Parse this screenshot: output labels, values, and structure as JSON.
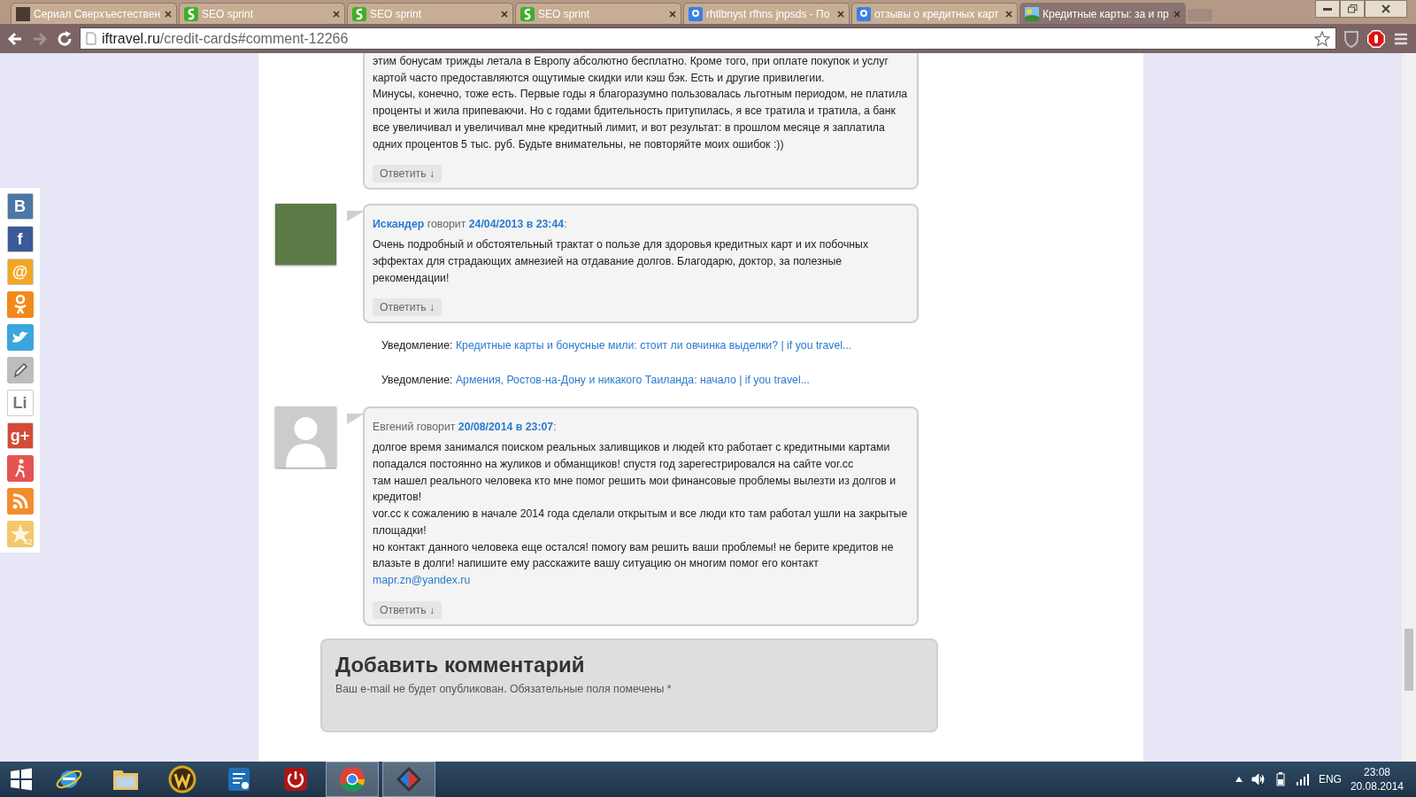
{
  "browser": {
    "tabs": [
      {
        "title": "Сериал Сверхъестествен",
        "kind": "thumbnail",
        "selected": false
      },
      {
        "title": "SEO sprint",
        "kind": "seo",
        "selected": false
      },
      {
        "title": "SEO sprint",
        "kind": "seo",
        "selected": false
      },
      {
        "title": "SEO sprint",
        "kind": "seo",
        "selected": false
      },
      {
        "title": "rhtlbnyst rfhns jnpsds - По",
        "kind": "tile",
        "selected": false
      },
      {
        "title": "отзывы о кредитных карт",
        "kind": "tile",
        "selected": false
      },
      {
        "title": "Кредитные карты: за и пр",
        "kind": "landscape",
        "selected": true
      }
    ],
    "url_host": "iftravel.ru",
    "url_path": "/credit-cards#comment-12266"
  },
  "share_bar": {
    "items": [
      {
        "kind": "vk",
        "glyph": "B"
      },
      {
        "kind": "facebook",
        "glyph": "f"
      },
      {
        "kind": "mail",
        "glyph": "@"
      },
      {
        "kind": "odnoklassniki"
      },
      {
        "kind": "twitter"
      },
      {
        "kind": "pencil"
      },
      {
        "kind": "liveinternet",
        "glyph": "Li"
      },
      {
        "kind": "googleplus",
        "glyph": "g+"
      },
      {
        "kind": "person"
      },
      {
        "kind": "rss"
      },
      {
        "kind": "star",
        "count": "42"
      }
    ]
  },
  "comments": [
    {
      "kind": "continued",
      "lines": [
        {
          "text": "этим бонусам трижды летала в Европу абсолютно бесплатно. Кроме того, при оплате покупок и услуг"
        },
        {
          "text": "картой часто предоставляются ощутимые скидки или кэш бэк. Есть и другие привилегии."
        },
        {
          "text": "Минусы, конечно, тоже есть. Первые годы я благоразумно пользовалась льготным периодом, не платила"
        },
        {
          "text": "проценты и жила припеваючи. Но с годами бдительность притупилась, я все тратила и тратила, а банк"
        },
        {
          "text": "все увеличивал и увеличивал мне кредитный лимит, и вот результат: в прошлом месяце я заплатила"
        },
        {
          "text": "одних процентов 5 тыс. руб. Будьте внимательны, не повторяйте моих ошибок :))"
        }
      ],
      "reply": "Ответить ↓"
    },
    {
      "kind": "photo",
      "author": {
        "name": "Искандер",
        "linked": true
      },
      "says": "говорит",
      "date": "24/04/2013 в 23:44",
      "separator": ":",
      "lines": [
        {
          "text": "Очень подробный и обстоятельный трактат о пользе для здоровья кредитных карт и их побочных"
        },
        {
          "text": "эффектах для страдающих амнезией на отдавание долгов. Благодарю, доктор, за полезные"
        },
        {
          "text": "рекомендации!"
        }
      ],
      "reply": "Ответить ↓"
    },
    {
      "kind": "notification",
      "label": "Уведомление:",
      "link": "Кредитные карты и бонусные мили: стоит ли овчинка выделки? | if you travel..."
    },
    {
      "kind": "notification",
      "label": "Уведомление:",
      "link": "Армения, Ростов-на-Дону и никакого Таиланда: начало | if you travel..."
    },
    {
      "kind": "default",
      "author": {
        "name": "Евгений",
        "linked": false
      },
      "says": "говорит",
      "date": "20/08/2014 в 23:07",
      "separator": ":",
      "lines": [
        {
          "text": "долгое время занимался поиском реальных заливщиков и людей кто работает с кредитными картами"
        },
        {
          "text": "попадался постоянно на жуликов и обманщиков! спустя год зарегестрировался на сайте vor.cc"
        },
        {
          "text": "там нашел реального человека кто мне помог решить мои финансовые проблемы вылезти из долгов и"
        },
        {
          "text": "кредитов!"
        },
        {
          "text": "vor.cc к сожалению в начале 2014 года сделали открытым и все люди кто там работал ушли на закрытые"
        },
        {
          "text": "площадки!"
        },
        {
          "text": "но контакт данного человека еще остался! помогу вам решить ваши проблемы! не берите кредитов не"
        },
        {
          "text": "влазьте в долги! напишите ему расскажите вашу ситуацию он многим помог его контакт"
        },
        {
          "text": "mapr.zn@yandex.ru",
          "kind": "link"
        }
      ],
      "reply": "Ответить ↓"
    }
  ],
  "comment_form": {
    "title": "Добавить комментарий",
    "note": "Ваш e-mail не будет опубликован. Обязательные поля помечены *"
  },
  "taskbar": {
    "apps": [
      {
        "kind": "ie",
        "active": false
      },
      {
        "kind": "folder",
        "active": false
      },
      {
        "kind": "emblem",
        "active": false
      },
      {
        "kind": "document",
        "active": false
      },
      {
        "kind": "power",
        "active": false
      },
      {
        "kind": "chrome",
        "active": true
      },
      {
        "kind": "diamond",
        "active": true
      }
    ],
    "language": "ENG",
    "time": "23:08",
    "date": "20.08.2014"
  }
}
